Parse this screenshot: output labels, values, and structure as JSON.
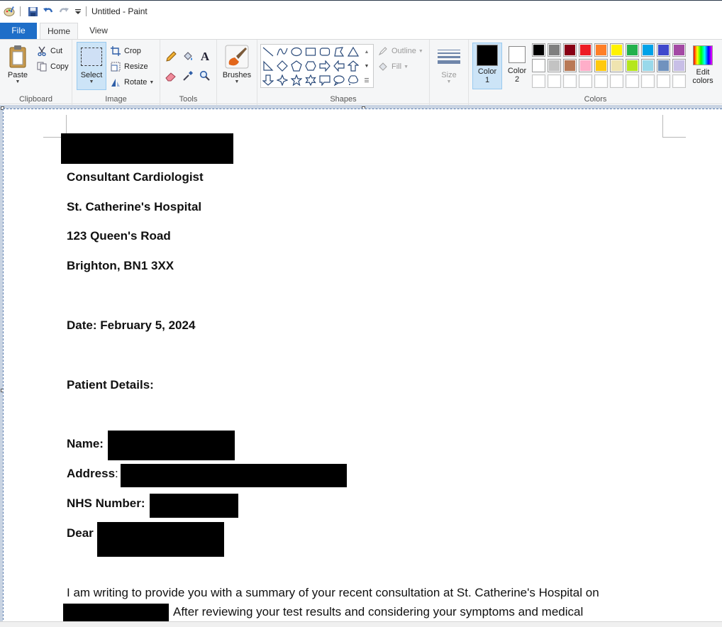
{
  "window": {
    "title": "Untitled - Paint"
  },
  "tabs": {
    "file": "File",
    "home": "Home",
    "view": "View"
  },
  "clipboard": {
    "paste": "Paste",
    "cut": "Cut",
    "copy": "Copy",
    "label": "Clipboard"
  },
  "image": {
    "select": "Select",
    "crop": "Crop",
    "resize": "Resize",
    "rotate": "Rotate",
    "label": "Image"
  },
  "tools": {
    "label": "Tools"
  },
  "brushes": {
    "label": "Brushes"
  },
  "shapes": {
    "outline": "Outline",
    "fill": "Fill",
    "label": "Shapes"
  },
  "size": {
    "label": "Size"
  },
  "colors": {
    "color1_label": "Color",
    "color1_num": "1",
    "color2_label": "Color",
    "color2_num": "2",
    "label": "Colors",
    "edit_label": "Edit",
    "edit_label2": "colors",
    "color1_value": "#000000",
    "color2_value": "#ffffff",
    "palette_row1": [
      "#000000",
      "#7f7f7f",
      "#880015",
      "#ed1c24",
      "#ff7f27",
      "#fff200",
      "#22b14c",
      "#00a2e8",
      "#3f48cc",
      "#a349a4"
    ],
    "palette_row2": [
      "#ffffff",
      "#c3c3c3",
      "#b97a57",
      "#ffaec9",
      "#ffc90e",
      "#efe4b0",
      "#b5e61d",
      "#99d9ea",
      "#7092be",
      "#c8bfe7"
    ],
    "palette_row3": [
      "#ffffff",
      "#ffffff",
      "#ffffff",
      "#ffffff",
      "#ffffff",
      "#ffffff",
      "#ffffff",
      "#ffffff",
      "#ffffff",
      "#ffffff"
    ]
  },
  "document": {
    "title_line": "Consultant Cardiologist",
    "hospital": "St. Catherine's Hospital",
    "street": "123 Queen's Road",
    "city": "Brighton, BN1 3XX",
    "date": "Date: February 5, 2024",
    "patient_details": "Patient Details:",
    "name_label": "Name:",
    "address_label": "Address",
    "address_colon": ":",
    "nhs_label": "NHS Number:",
    "dear_label": "Dear",
    "para_line1": "I am writing to provide you with a summary of your recent consultation at St. Catherine's Hospital on",
    "para_line2": "After reviewing your test results and considering your symptoms and medical"
  }
}
